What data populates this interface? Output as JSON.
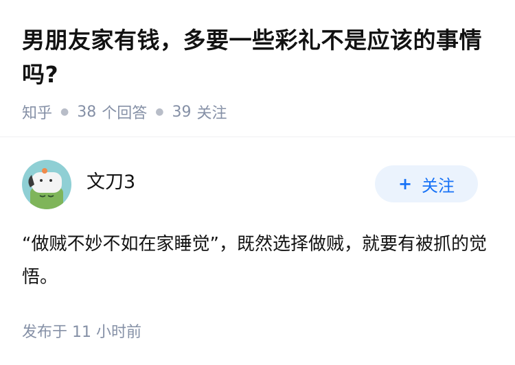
{
  "question": {
    "title": "男朋友家有钱，多要一些彩礼不是应该的事情吗?",
    "source": "知乎",
    "answer_count": "38",
    "answer_label": "个回答",
    "follow_count": "39",
    "follow_label": "关注"
  },
  "answer": {
    "author": {
      "name": "文刀3",
      "avatar_icon": "cartoon-dog-avatar"
    },
    "follow_button": {
      "icon": "plus-icon",
      "icon_glyph": "+",
      "label": "关注"
    },
    "content": "“做贼不妙不如在家睡觉”，既然选择做贼，就要有被抓的觉悟。",
    "published": "发布于  11 小时前"
  },
  "colors": {
    "meta_gray": "#8590a6",
    "accent_blue": "#1772f6",
    "button_bg": "#ebf3fd",
    "avatar_bg": "#8fcfd4",
    "avatar_body": "#7fb55a"
  }
}
